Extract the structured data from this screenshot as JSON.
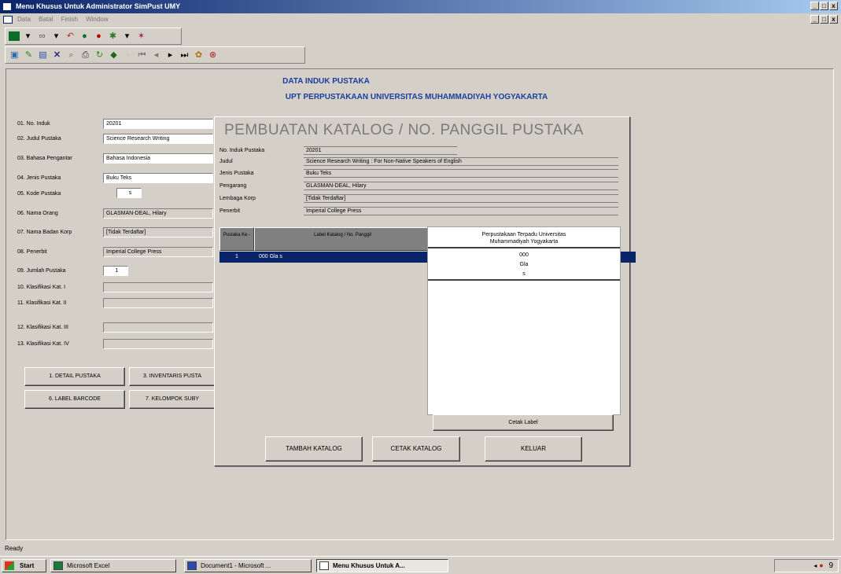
{
  "window": {
    "title": "Menu Khusus Untuk Administrator SimPust UMY",
    "controls": [
      "_",
      "□",
      "x"
    ]
  },
  "menubar": {
    "items": [
      "Data",
      "Batal",
      "Finish",
      "Window"
    ]
  },
  "form": {
    "header1": "DATA  INDUK PUSTAKA",
    "header2": "UPT PERPUSTAKAAN UNIVERSITAS MUHAMMADIYAH YOGYAKARTA",
    "fields": [
      {
        "label": "01. No. Induk",
        "value": "20201"
      },
      {
        "label": "02. Judul Pustaka",
        "value": "Science Research Writing"
      },
      {
        "label": "03. Bahasa Pengantar",
        "value": "Bahasa Indonesia"
      },
      {
        "label": "04. Jenis Pustaka",
        "value": "Buku Teks"
      },
      {
        "label": "05. Kode Pustaka",
        "value": "s"
      },
      {
        "label": "06. Nama Orang",
        "value": "GLASMAN-DEAL, Hilary"
      },
      {
        "label": "07. Nama Badan Korp",
        "value": "[Tidak Terdaftar]"
      },
      {
        "label": "08. Penerbit",
        "value": "Imperial College Press"
      },
      {
        "label": "09. Jumlah Pustaka",
        "value": "1"
      },
      {
        "label": "10. Klasifikasi Kat. I",
        "value": ""
      },
      {
        "label": "11. Klasifikasi Kat. II",
        "value": ""
      },
      {
        "label": "12. Klasifikasi Kat. III",
        "value": ""
      },
      {
        "label": "13. Klasifikasi Kat. IV",
        "value": ""
      }
    ],
    "buttons": {
      "detail": "1. DETAIL PUSTAKA",
      "inventaris": "3. INVENTARIS PUSTA",
      "barcode": "6. LABEL BARCODE",
      "kelompok": "7. KELOMPOK SUBY"
    }
  },
  "dialog": {
    "title": "PEMBUATAN KATALOG / NO. PANGGIL PUSTAKA",
    "fields": [
      {
        "label": "No. Induk Pustaka",
        "value": "20201"
      },
      {
        "label": "Judul",
        "value": "Science Research Writing : For Non-Native Speakers of English"
      },
      {
        "label": "Jenis Pustaka",
        "value": "Buku Teks"
      },
      {
        "label": "Pengarang",
        "value": "GLASMAN-DEAL, Hilary"
      },
      {
        "label": "Lembaga Korp",
        "value": "[Tidak Terdaftar]"
      },
      {
        "label": "Penerbit",
        "value": "Imperial College Press"
      }
    ],
    "grid": {
      "col1": "Pustaka Ke -",
      "col2": "Label Katalog / No. Panggil",
      "rows": [
        {
          "no": "1",
          "label": "000 Gla s"
        }
      ]
    },
    "preview": {
      "line1": "Perpustakaan Terpadu Universitas",
      "line2": "Muhammadiyah Yogyakarta",
      "code": "000",
      "author": "Gla",
      "title": "s"
    },
    "buttons": {
      "cetak_label": "Cetak Label",
      "tambah": "TAMBAH KATALOG",
      "cetak": "CETAK KATALOG",
      "keluar": "KELUAR"
    }
  },
  "status": "Ready",
  "taskbar": {
    "start": "Start",
    "items": [
      "Microsoft Excel",
      "Document1 - Microsoft ...",
      "Menu Khusus Untuk A..."
    ],
    "clock": "9"
  }
}
